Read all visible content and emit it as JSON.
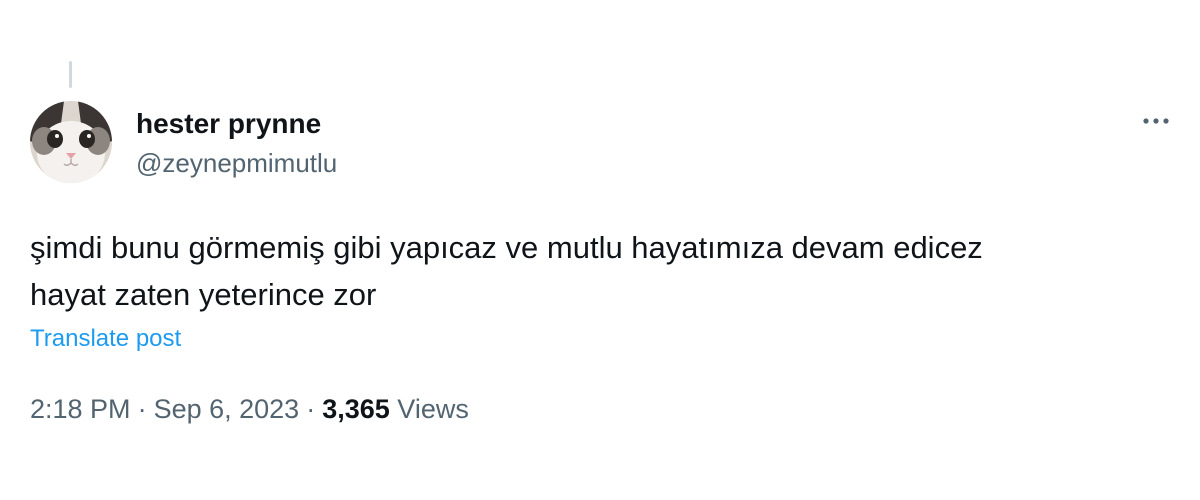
{
  "author": {
    "display_name": "hester prynne",
    "handle": "@zeynepmimutlu"
  },
  "tweet": {
    "text_lines": [
      "şimdi bunu görmemiş gibi yapıcaz ve mutlu hayatımıza devam edicez",
      "hayat zaten yeterince zor"
    ],
    "translate_label": "Translate post",
    "time": "2:18 PM",
    "separator": "·",
    "date": "Sep 6, 2023",
    "views_count": "3,365",
    "views_label": "Views"
  },
  "icons": {
    "more": "more-horizontal-icon",
    "avatar": "cat-avatar"
  },
  "colors": {
    "text": "#0f1419",
    "secondary": "#536471",
    "link": "#1d9bf0",
    "thread_line": "#cfd9de"
  }
}
